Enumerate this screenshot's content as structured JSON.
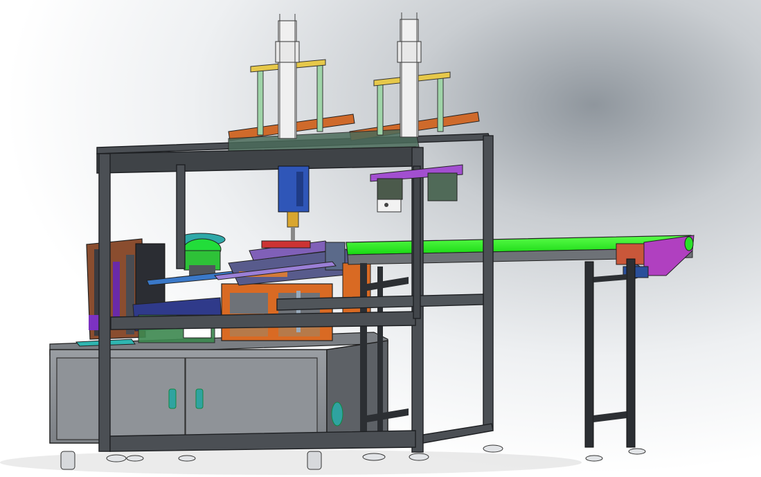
{
  "viewport": {
    "label": "",
    "background_top": "#9aa0a6",
    "background_bottom": "#ffffff"
  },
  "colors": {
    "frame": "#4b4f54",
    "frame_edge": "#222426",
    "cabinet": "#8a8e93",
    "cabinet_dark": "#6f7378",
    "belt": "#2aff20",
    "orange": "#cf6a2b",
    "handle": "#2fa3a0",
    "column_green": "#9fd4a8",
    "plate_yellow": "#e6c84a",
    "purple": "#9a3fd0",
    "blue_block": "#2f56b8",
    "teal_table": "#3f9aa0"
  },
  "icons": [
    "conveyor-motor-icon",
    "cabinet-handle-icon",
    "vent-icon",
    "caster-wheel-icon"
  ]
}
